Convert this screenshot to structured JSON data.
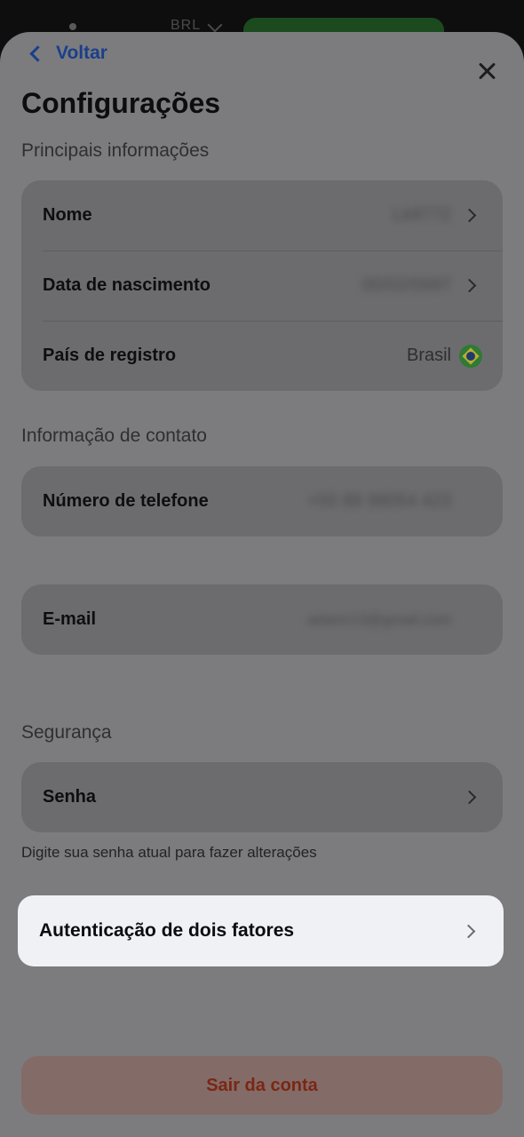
{
  "status_bar": {
    "carrier_text": "BRL"
  },
  "header": {
    "back_label": "Voltar",
    "title": "Configurações"
  },
  "sections": {
    "main_info": {
      "label": "Principais informações",
      "rows": [
        {
          "label": "Nome",
          "value": "Lk8772"
        },
        {
          "label": "Data de nascimento",
          "value": "00/02/0997"
        },
        {
          "label": "País de registro",
          "value": "Brasil",
          "icon": "brazil-flag-icon"
        }
      ]
    },
    "contact": {
      "label": "Informação de contato",
      "phone": {
        "label": "Número de telefone",
        "value": "+55 88 99054 423"
      },
      "email": {
        "label": "E-mail",
        "value": "adamr13@gmail.com"
      }
    },
    "security": {
      "label": "Segurança",
      "password": {
        "label": "Senha"
      },
      "hint": "Digite sua senha atual para fazer alterações",
      "two_factor": {
        "label": "Autenticação de dois fatores"
      }
    }
  },
  "logout_label": "Sair da conta",
  "colors": {
    "accent": "#1b3f8a",
    "logout_text": "#7a2714",
    "highlight_bg": "#f0f1f5"
  }
}
